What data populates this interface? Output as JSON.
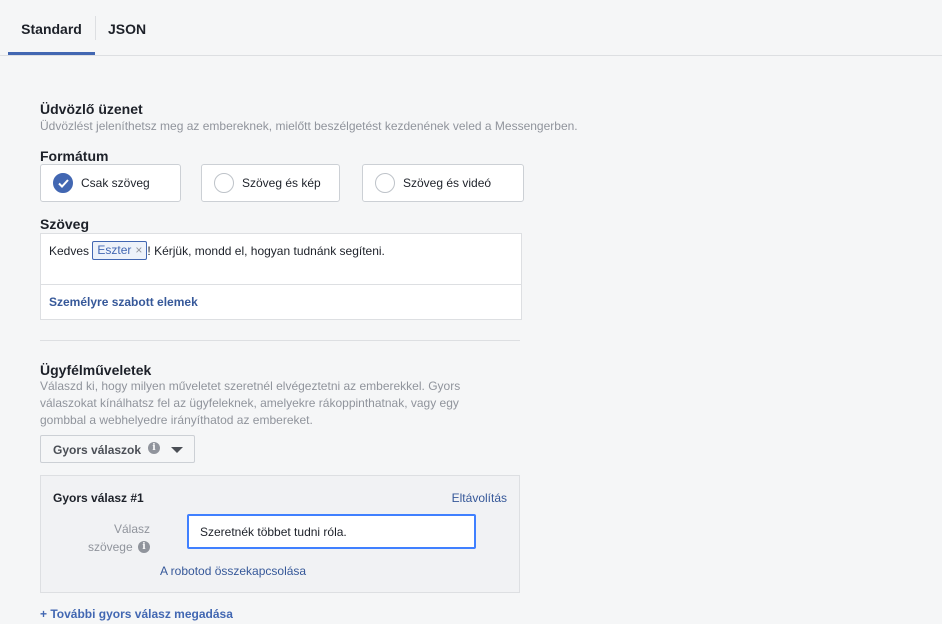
{
  "tabs": {
    "standard": "Standard",
    "json": "JSON"
  },
  "welcome": {
    "title": "Üdvözlő üzenet",
    "subtitle": "Üdvözlést jeleníthetsz meg az embereknek, mielőtt beszélgetést kezdenének veled a Messengerben."
  },
  "format": {
    "title": "Formátum",
    "options": [
      "Csak szöveg",
      "Szöveg és kép",
      "Szöveg és videó"
    ],
    "selected": "Csak szöveg"
  },
  "text": {
    "title": "Szöveg",
    "prefix": "Kedves",
    "token": "Eszter",
    "token_remove": "×",
    "suffix": "! Kérjük, mondd el, hogyan tudnánk segíteni.",
    "personalize_link": "Személyre szabott elemek"
  },
  "actions": {
    "title": "Ügyfélműveletek",
    "description_lines": [
      "Válaszd ki, hogy milyen műveletet szeretnél elvégeztetni az emberekkel. Gyors",
      "válaszokat kínálhatsz fel az ügyfeleknek, amelyekre rákoppinthatnak, vagy egy",
      "gombbal a webhelyedre irányíthatod az embereket."
    ],
    "dropdown_label": "Gyors válaszok",
    "info_glyph": "i"
  },
  "quick_reply": {
    "title": "Gyors válasz #1",
    "remove": "Eltávolítás",
    "field_label_line1": "Válasz",
    "field_label_line2": "szövege",
    "value": "Szeretnék többet tudni róla.",
    "connect_link": "A robotod összekapcsolása"
  },
  "add_more": "+ További gyors válasz megadása",
  "colors": {
    "accent": "#4267b2",
    "link": "#365899",
    "focus": "#4080ff"
  }
}
